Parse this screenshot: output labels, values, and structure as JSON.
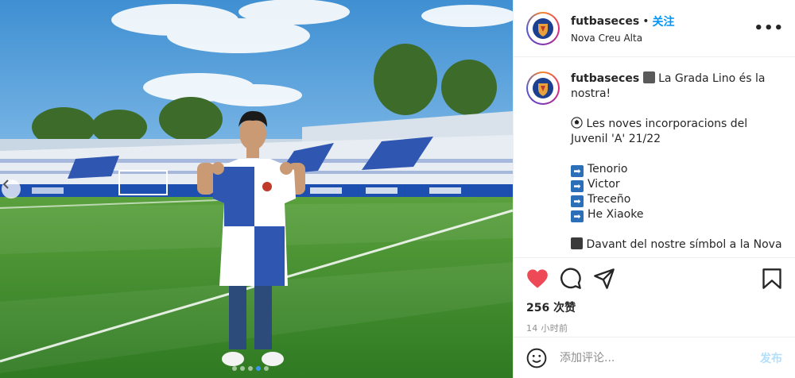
{
  "post": {
    "username": "futbaseces",
    "follow_label": "关注",
    "separator": "•",
    "location": "Nova Creu Alta",
    "more_label": "•••"
  },
  "caption": {
    "username": "futbaseces",
    "line1": "La Grada Lino és la nostra!",
    "line2": "Les noves incorporacions del Juvenil 'A' 21/22",
    "players": [
      "Tenorio",
      "Victor",
      "Treceño",
      "He Xiaoke"
    ],
    "line3": "Davant del nostre símbol a la Nova"
  },
  "stats": {
    "likes": "256 次赞",
    "time": "14 小时前"
  },
  "comment": {
    "placeholder": "添加评论...",
    "post_label": "发布"
  },
  "colors": {
    "like": "#ed4956",
    "follow": "#0095f6",
    "kit_blue": "#2f56b0",
    "grass": "#3f8f2e"
  },
  "carousel": {
    "slide_count": 5,
    "active_index": 0
  }
}
